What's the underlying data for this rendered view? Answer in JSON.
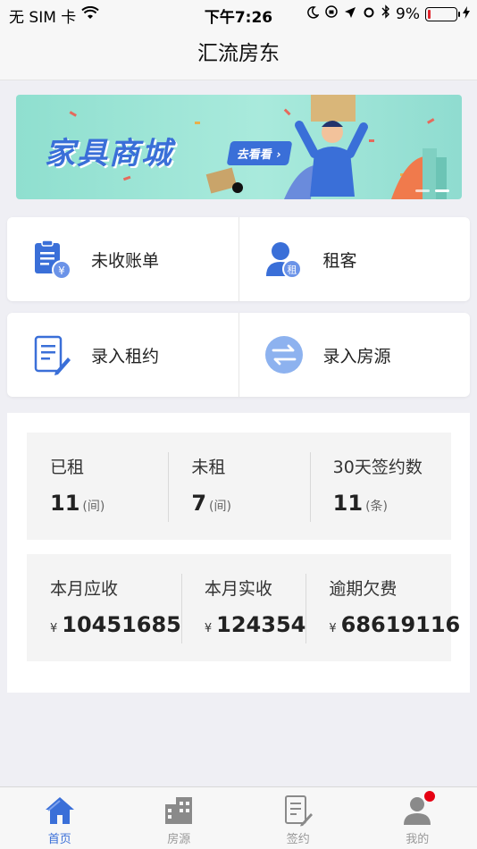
{
  "status_bar": {
    "carrier": "无 SIM 卡",
    "time": "下午7:26",
    "battery": "9%"
  },
  "nav": {
    "title": "汇流房东"
  },
  "banner": {
    "title": "家具商城",
    "button": "去看看",
    "slides": 2,
    "active_slide": 1
  },
  "quick_actions": [
    {
      "label": "未收账单",
      "icon": "bill-icon"
    },
    {
      "label": "租客",
      "icon": "tenant-icon"
    },
    {
      "label": "录入租约",
      "icon": "contract-edit-icon"
    },
    {
      "label": "录入房源",
      "icon": "exchange-icon"
    }
  ],
  "stats": {
    "rooms": [
      {
        "label": "已租",
        "value": "11",
        "unit": "(间)"
      },
      {
        "label": "未租",
        "value": "7",
        "unit": "(间)"
      },
      {
        "label": "30天签约数",
        "value": "11",
        "unit": "(条)"
      }
    ],
    "finance": [
      {
        "label": "本月应收",
        "currency": "¥",
        "value": "10451685"
      },
      {
        "label": "本月实收",
        "currency": "¥",
        "value": "124354"
      },
      {
        "label": "逾期欠费",
        "currency": "¥",
        "value": "68619116"
      }
    ]
  },
  "tabs": [
    {
      "label": "首页",
      "icon": "home-icon",
      "active": true
    },
    {
      "label": "房源",
      "icon": "building-icon",
      "active": false
    },
    {
      "label": "签约",
      "icon": "sign-icon",
      "active": false
    },
    {
      "label": "我的",
      "icon": "user-icon",
      "active": false
    }
  ],
  "colors": {
    "accent": "#3a6fd8",
    "badge": "#e60012"
  }
}
